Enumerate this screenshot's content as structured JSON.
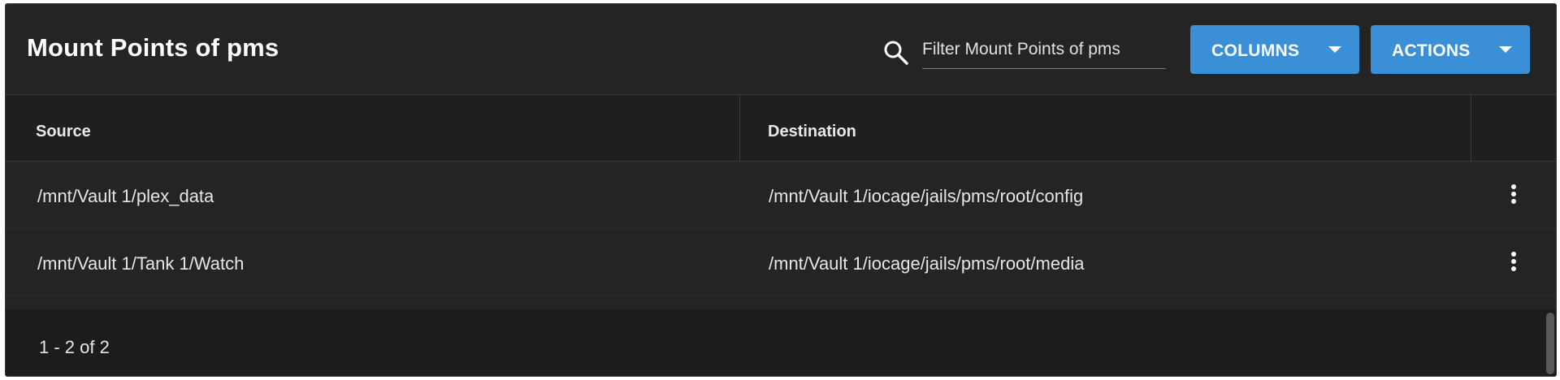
{
  "toolbar": {
    "title": "Mount Points of pms",
    "search_placeholder": "Filter Mount Points of pms",
    "columns_label": "COLUMNS",
    "actions_label": "ACTIONS"
  },
  "table": {
    "headers": [
      "Source",
      "Destination"
    ],
    "rows": [
      {
        "source": "/mnt/Vault 1/plex_data",
        "destination": "/mnt/Vault 1/iocage/jails/pms/root/config"
      },
      {
        "source": "/mnt/Vault 1/Tank 1/Watch",
        "destination": "/mnt/Vault 1/iocage/jails/pms/root/media"
      }
    ]
  },
  "footer": {
    "paging": "1 - 2 of 2"
  },
  "colors": {
    "accent": "#3b8fd7",
    "background": "#1f1f1f"
  },
  "icons": {
    "search": "search-icon",
    "menu": "more-vert-icon",
    "dropdown": "caret-down-icon"
  }
}
